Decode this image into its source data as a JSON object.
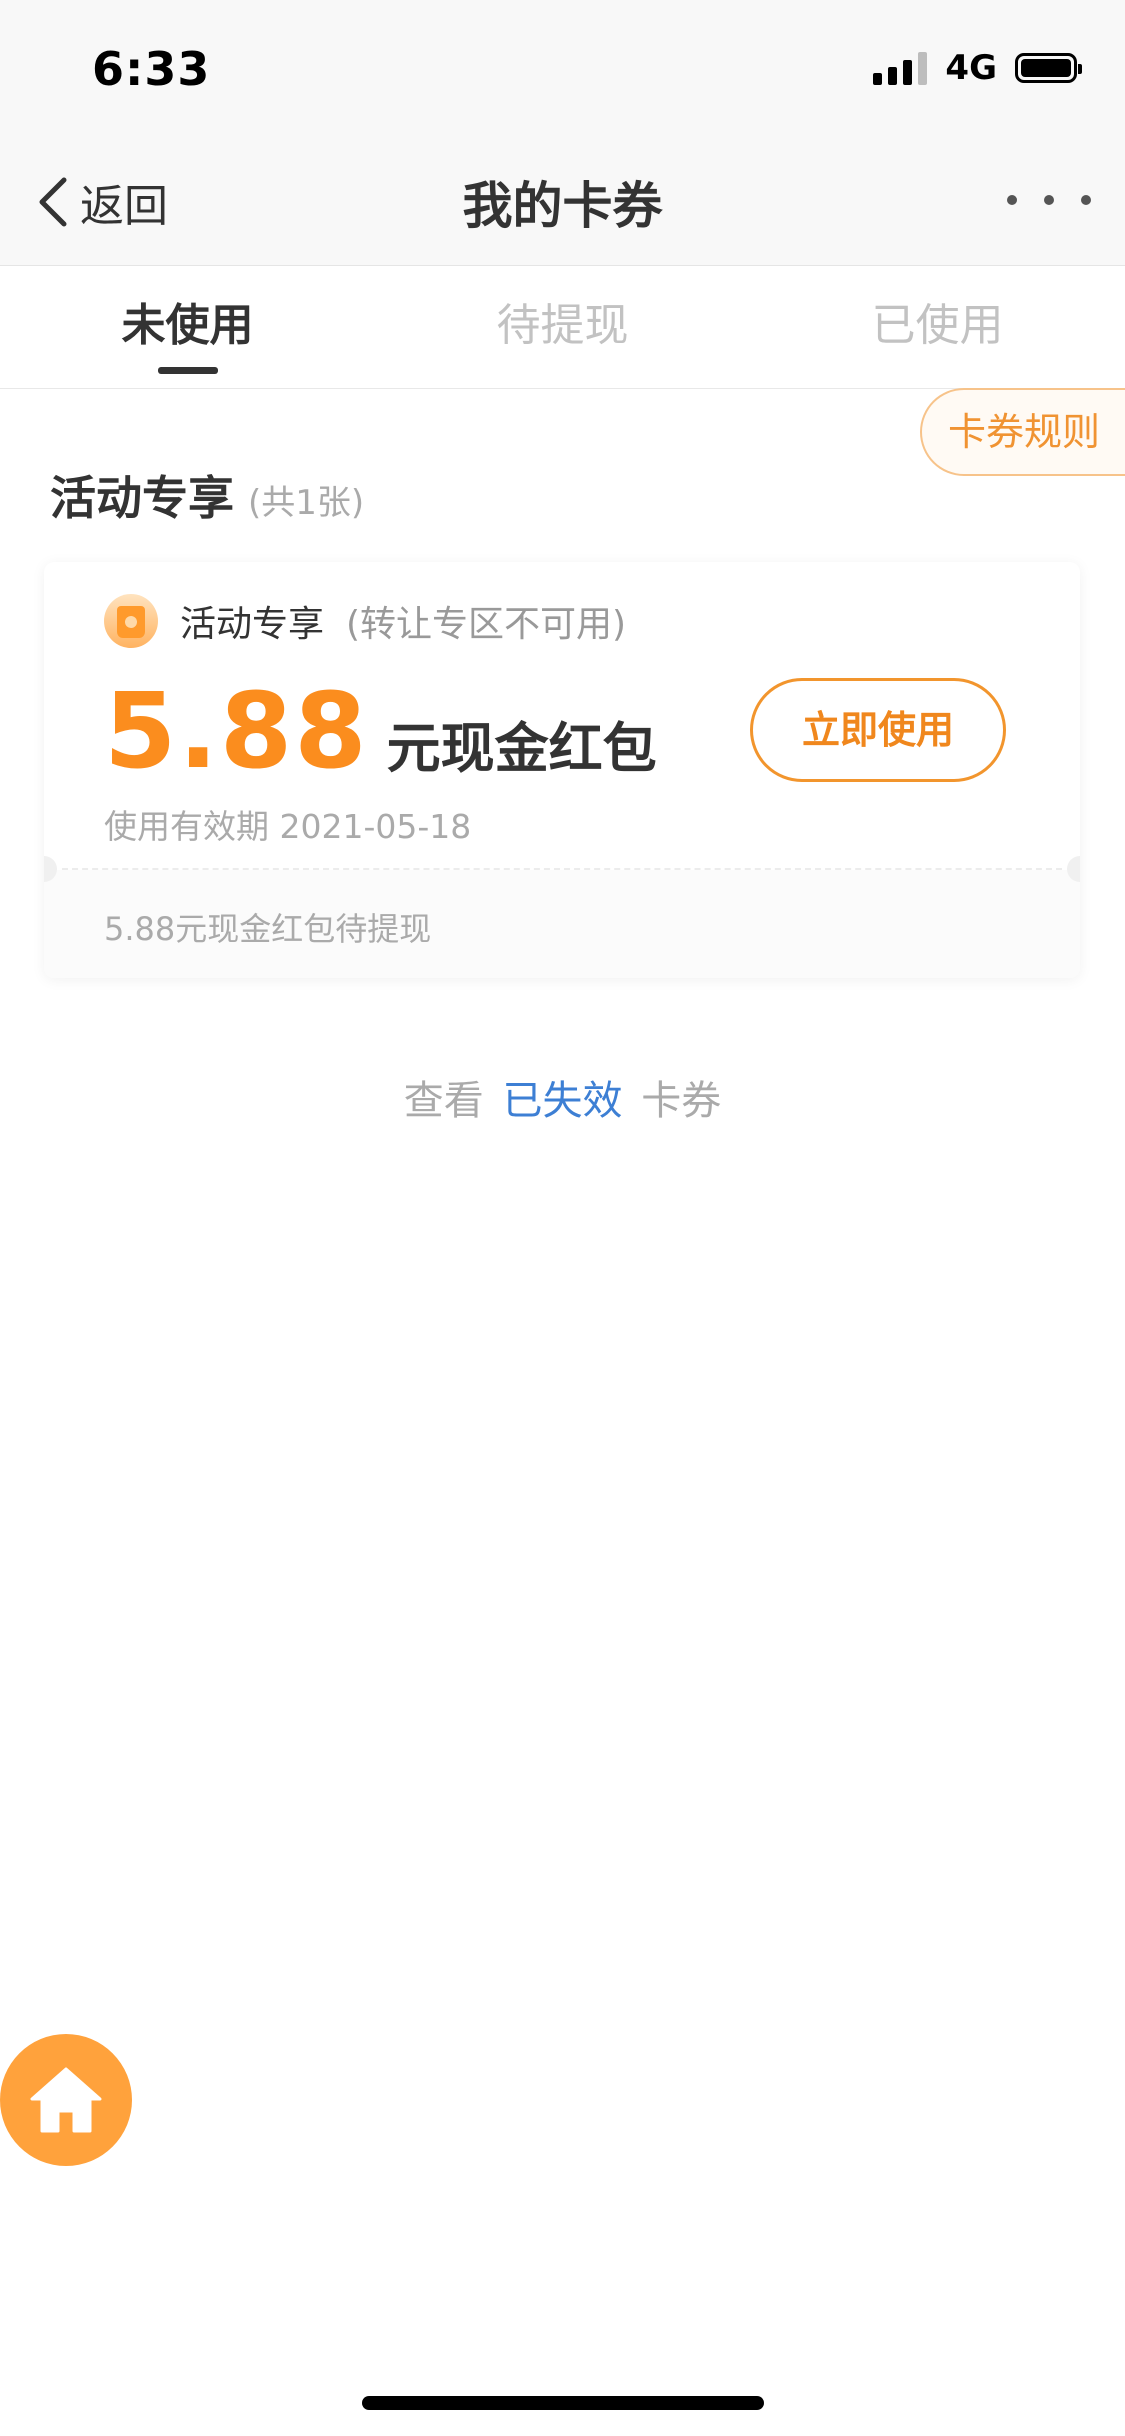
{
  "status_bar": {
    "time": "6:33",
    "network": "4G",
    "icons": [
      "signal-icon",
      "battery-icon"
    ]
  },
  "nav": {
    "back_label": "返回",
    "title": "我的卡券",
    "icons": [
      "chevron-left-icon",
      "more-icon"
    ]
  },
  "tabs": [
    {
      "label": "未使用",
      "active": true
    },
    {
      "label": "待提现",
      "active": false
    },
    {
      "label": "已使用",
      "active": false
    }
  ],
  "rules_label": "卡券规则",
  "section": {
    "name": "活动专享",
    "count": "(共1张)"
  },
  "coupon": {
    "type": "活动专享",
    "limit": "(转让专区不可用)",
    "amount": "5.88",
    "unit": "元现金红包",
    "action_label": "立即使用",
    "validity": "使用有效期 2021-05-18",
    "footer": "5.88元现金红包待提现",
    "icon": "coin-icon"
  },
  "expired": {
    "prefix": "查看",
    "link": "已失效",
    "suffix": "卡券"
  },
  "fab": {
    "icon": "home-icon"
  },
  "colors": {
    "accent": "#fb8d1e",
    "link": "#3d7fd4",
    "fab": "#ffa23c"
  }
}
